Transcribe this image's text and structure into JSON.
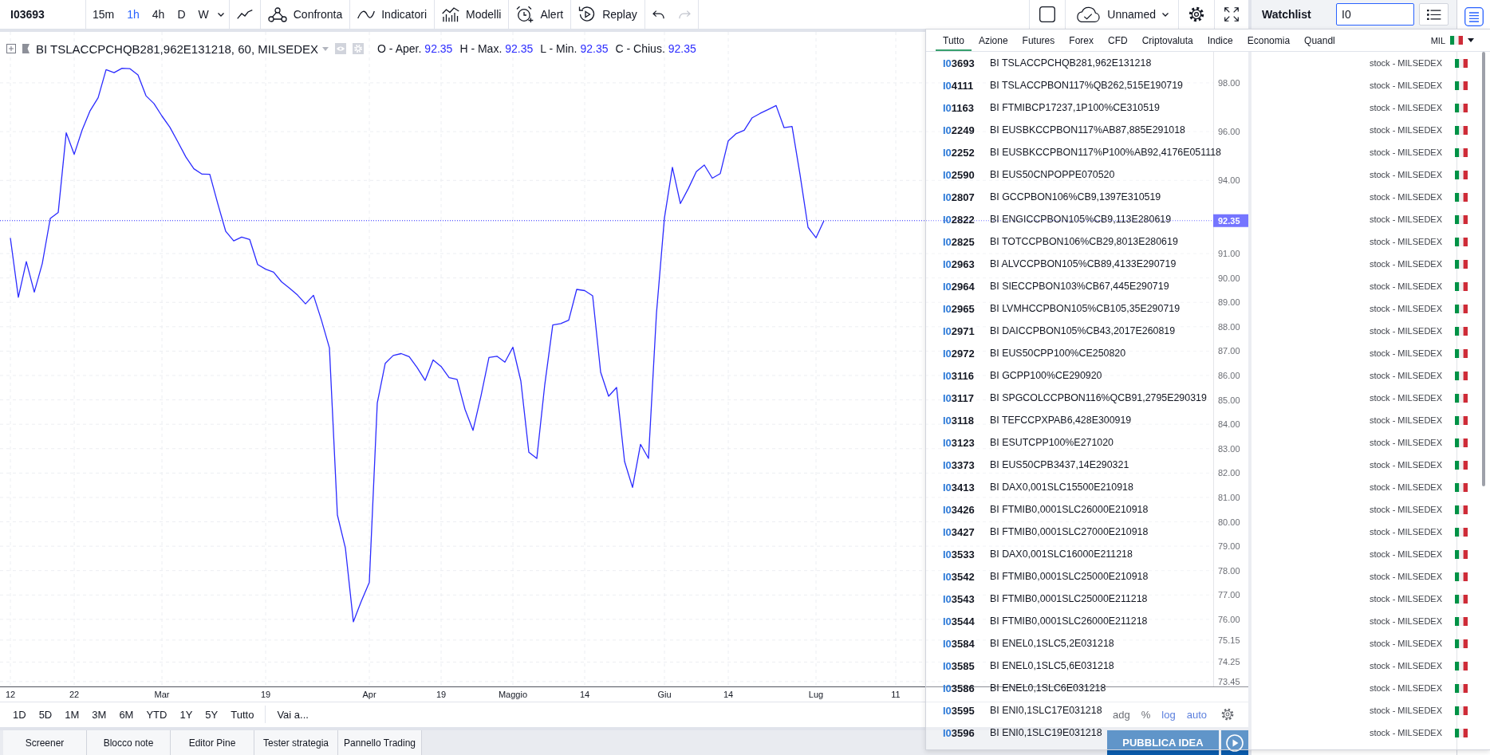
{
  "toolbar": {
    "symbol": "I03693",
    "intervals": [
      {
        "label": "15m",
        "selected": false
      },
      {
        "label": "1h",
        "selected": true
      },
      {
        "label": "4h",
        "selected": false
      },
      {
        "label": "D",
        "selected": false
      },
      {
        "label": "W",
        "selected": false
      }
    ],
    "tools": [
      {
        "label": "Confronta"
      },
      {
        "label": "Indicatori"
      },
      {
        "label": "Modelli"
      },
      {
        "label": "Alert"
      },
      {
        "label": "Replay"
      }
    ],
    "undo": {
      "disabled": false
    },
    "redo": {
      "disabled": true
    },
    "layout_name": "Unnamed"
  },
  "watchlist": {
    "title": "Watchlist",
    "search": {
      "value": "I0"
    }
  },
  "chart": {
    "legend": {
      "title": "BI TSLACCPCHQB281,962E131218, 60, MILSEDEX",
      "values": [
        {
          "label": "O - Aper.",
          "value": "92.35"
        },
        {
          "label": "H - Max.",
          "value": "92.35"
        },
        {
          "label": "L - Min.",
          "value": "92.35"
        },
        {
          "label": "C - Chius.",
          "value": "92.35"
        }
      ]
    },
    "chart_data": {
      "type": "line",
      "grid": true,
      "categories": [
        "12",
        null,
        null,
        null,
        null,
        null,
        null,
        null,
        "22",
        null,
        null,
        null,
        null,
        null,
        null,
        null,
        null,
        null,
        null,
        "Mar",
        null,
        null,
        null,
        null,
        null,
        null,
        null,
        null,
        null,
        null,
        null,
        null,
        "19",
        null,
        null,
        null,
        null,
        null,
        null,
        null,
        null,
        null,
        null,
        null,
        null,
        "Apr",
        null,
        null,
        null,
        null,
        null,
        null,
        null,
        null,
        "19",
        null,
        null,
        null,
        null,
        null,
        null,
        null,
        null,
        "Maggio",
        null,
        null,
        null,
        null,
        null,
        null,
        null,
        null,
        "14",
        null,
        null,
        null,
        null,
        null,
        null,
        null,
        null,
        null,
        "Giu",
        null,
        null,
        null,
        null,
        null,
        null,
        null,
        "14",
        null,
        null,
        null,
        null,
        null,
        null,
        null,
        null,
        null,
        null,
        "Lug",
        null,
        null,
        null,
        null,
        null,
        null,
        null,
        null,
        null,
        "11",
        null,
        null,
        null,
        null,
        null,
        null,
        null,
        null,
        null,
        null,
        null,
        null,
        null,
        null,
        null,
        null,
        null,
        null,
        null,
        null,
        null,
        null,
        null,
        null,
        null,
        null,
        null,
        null,
        null,
        null,
        null,
        null,
        null,
        null,
        null,
        null,
        null,
        null,
        null
      ],
      "series": [
        {
          "color": "#2b2bff",
          "values": [
            91.64,
            89.21,
            90.67,
            89.42,
            90.59,
            92.44,
            92.69,
            95.95,
            95.07,
            96.07,
            96.86,
            97.39,
            98.54,
            98.42,
            98.6,
            98.58,
            98.32,
            97.47,
            97.15,
            96.64,
            96.18,
            95.58,
            94.96,
            94.48,
            94.26,
            94.25,
            93.05,
            91.91,
            91.52,
            91.68,
            91.58,
            90.55,
            90.36,
            90.24,
            89.84,
            89.58,
            89.3,
            88.94,
            89.29,
            88.27,
            87.13,
            80.28,
            78.93,
            75.9,
            76.75,
            77.52,
            84.88,
            86.5,
            86.82,
            86.9,
            86.77,
            86.32,
            85.8,
            86.64,
            86.37,
            85.91,
            85.84,
            84.61,
            83.75,
            85.16,
            86.74,
            86.79,
            86.55,
            87.16,
            85.77,
            82.85,
            82.6,
            85.63,
            88.07,
            88.13,
            88.27,
            89.53,
            89.48,
            89.27,
            86.14,
            85.15,
            85.51,
            82.48,
            81.41,
            83.18,
            82.6,
            88.55,
            92.46,
            94.54,
            93.05,
            93.67,
            94.36,
            94.63,
            94.09,
            94.28,
            95.62,
            95.92,
            96.06,
            96.57,
            96.75,
            96.91,
            97.07,
            96.16,
            96.21,
            94.23,
            92.08,
            91.65,
            92.35,
            null,
            null,
            null,
            null,
            null,
            null,
            null,
            null,
            null,
            null,
            null,
            null,
            null,
            null,
            null,
            null,
            null,
            null,
            null,
            null,
            null,
            null,
            null,
            null,
            null,
            null,
            null,
            null,
            null,
            null,
            null,
            null,
            null,
            null,
            null,
            null,
            null,
            null,
            null,
            null,
            null,
            null,
            null,
            null,
            null,
            null,
            null,
            null
          ]
        }
      ],
      "ref_lines": [
        {
          "axis": "y",
          "value": 92.35,
          "label": "92.35",
          "color": "#2b2bff"
        }
      ],
      "ylim": [
        73.25,
        100.09
      ],
      "yticks": [
        {
          "value": 98,
          "label": "98.00"
        },
        {
          "value": 96,
          "label": "96.00"
        },
        {
          "value": 94,
          "label": "94.00"
        },
        {
          "value": 91,
          "label": "91.00"
        },
        {
          "value": 90,
          "label": "90.00"
        },
        {
          "value": 89,
          "label": "89.00"
        },
        {
          "value": 88,
          "label": "88.00"
        },
        {
          "value": 87,
          "label": "87.00"
        },
        {
          "value": 86,
          "label": "86.00"
        },
        {
          "value": 85,
          "label": "85.00"
        },
        {
          "value": 84,
          "label": "84.00"
        },
        {
          "value": 83,
          "label": "83.00"
        },
        {
          "value": 82,
          "label": "82.00"
        },
        {
          "value": 81,
          "label": "81.00"
        },
        {
          "value": 80,
          "label": "80.00"
        },
        {
          "value": 79,
          "label": "79.00"
        },
        {
          "value": 78,
          "label": "78.00"
        },
        {
          "value": 77,
          "label": "77.00"
        },
        {
          "value": 76,
          "label": "76.00"
        },
        {
          "value": 75.15,
          "label": "75.15"
        },
        {
          "value": 74.25,
          "label": "74.25"
        },
        {
          "value": 73.45,
          "label": "73.45"
        }
      ]
    }
  },
  "date_ranges": [
    "1D",
    "5D",
    "1M",
    "3M",
    "6M",
    "YTD",
    "1Y",
    "5Y",
    "Tutto"
  ],
  "go_to": "Vai a...",
  "scale_options": [
    {
      "label": "adg",
      "selected": false
    },
    {
      "label": "%",
      "selected": false
    },
    {
      "label": "log",
      "selected": true
    },
    {
      "label": "auto",
      "selected": true
    }
  ],
  "bottom_tabs": [
    "Screener",
    "Blocco note",
    "Editor Pine",
    "Tester strategia",
    "Pannello Trading"
  ],
  "publish_button": "PUBBLICA IDEA",
  "search_dropdown": {
    "tabs": [
      {
        "label": "Tutto",
        "selected": true
      },
      {
        "label": "Azione",
        "selected": false
      },
      {
        "label": "Futures",
        "selected": false
      },
      {
        "label": "Forex",
        "selected": false
      },
      {
        "label": "CFD",
        "selected": false
      },
      {
        "label": "Criptovaluta",
        "selected": false
      },
      {
        "label": "Indice",
        "selected": false
      },
      {
        "label": "Economia",
        "selected": false
      },
      {
        "label": "Quandl",
        "selected": false
      }
    ],
    "exchange": "MIL",
    "results": [
      {
        "match": "I0",
        "code": "3693",
        "description": "BI TSLACCPCHQB281,962E131218",
        "type": "stock - MILSEDEX"
      },
      {
        "match": "I0",
        "code": "4111",
        "description": "BI TSLACCPBON117%QB262,515E190719",
        "type": "stock - MILSEDEX"
      },
      {
        "match": "I0",
        "code": "1163",
        "description": "BI FTMIBCP17237,1P100%CE310519",
        "type": "stock - MILSEDEX"
      },
      {
        "match": "I0",
        "code": "2249",
        "description": "BI EUSBKCCPBON117%AB87,885E291018",
        "type": "stock - MILSEDEX"
      },
      {
        "match": "I0",
        "code": "2252",
        "description": "BI EUSBKCCPBON117%P100%AB92,4176E051118",
        "type": "stock - MILSEDEX"
      },
      {
        "match": "I0",
        "code": "2590",
        "description": "BI EUS50CNPOPPE070520",
        "type": "stock - MILSEDEX"
      },
      {
        "match": "I0",
        "code": "2807",
        "description": "BI GCCPBON106%CB9,1397E310519",
        "type": "stock - MILSEDEX"
      },
      {
        "match": "I0",
        "code": "2822",
        "description": "BI ENGICCPBON105%CB9,113E280619",
        "type": "stock - MILSEDEX"
      },
      {
        "match": "I0",
        "code": "2825",
        "description": "BI TOTCCPBON106%CB29,8013E280619",
        "type": "stock - MILSEDEX"
      },
      {
        "match": "I0",
        "code": "2963",
        "description": "BI ALVCCPBON105%CB89,4133E290719",
        "type": "stock - MILSEDEX"
      },
      {
        "match": "I0",
        "code": "2964",
        "description": "BI SIECCPBON103%CB67,445E290719",
        "type": "stock - MILSEDEX"
      },
      {
        "match": "I0",
        "code": "2965",
        "description": "BI LVMHCCPBON105%CB105,35E290719",
        "type": "stock - MILSEDEX"
      },
      {
        "match": "I0",
        "code": "2971",
        "description": "BI DAICCPBON105%CB43,2017E260819",
        "type": "stock - MILSEDEX"
      },
      {
        "match": "I0",
        "code": "2972",
        "description": "BI EUS50CPP100%CE250820",
        "type": "stock - MILSEDEX"
      },
      {
        "match": "I0",
        "code": "3116",
        "description": "BI GCPP100%CE290920",
        "type": "stock - MILSEDEX"
      },
      {
        "match": "I0",
        "code": "3117",
        "description": "BI SPGCOLCCPBON116%QCB91,2795E290319",
        "type": "stock - MILSEDEX"
      },
      {
        "match": "I0",
        "code": "3118",
        "description": "BI TEFCCPXPAB6,428E300919",
        "type": "stock - MILSEDEX"
      },
      {
        "match": "I0",
        "code": "3123",
        "description": "BI ESUTCPP100%E271020",
        "type": "stock - MILSEDEX"
      },
      {
        "match": "I0",
        "code": "3373",
        "description": "BI EUS50CPB3437,14E290321",
        "type": "stock - MILSEDEX"
      },
      {
        "match": "I0",
        "code": "3413",
        "description": "BI DAX0,001SLC15500E210918",
        "type": "stock - MILSEDEX"
      },
      {
        "match": "I0",
        "code": "3426",
        "description": "BI FTMIB0,0001SLC26000E210918",
        "type": "stock - MILSEDEX"
      },
      {
        "match": "I0",
        "code": "3427",
        "description": "BI FTMIB0,0001SLC27000E210918",
        "type": "stock - MILSEDEX"
      },
      {
        "match": "I0",
        "code": "3533",
        "description": "BI DAX0,001SLC16000E211218",
        "type": "stock - MILSEDEX"
      },
      {
        "match": "I0",
        "code": "3542",
        "description": "BI FTMIB0,0001SLC25000E210918",
        "type": "stock - MILSEDEX"
      },
      {
        "match": "I0",
        "code": "3543",
        "description": "BI FTMIB0,0001SLC25000E211218",
        "type": "stock - MILSEDEX"
      },
      {
        "match": "I0",
        "code": "3544",
        "description": "BI FTMIB0,0001SLC26000E211218",
        "type": "stock - MILSEDEX"
      },
      {
        "match": "I0",
        "code": "3584",
        "description": "BI ENEL0,1SLC5,2E031218",
        "type": "stock - MILSEDEX"
      },
      {
        "match": "I0",
        "code": "3585",
        "description": "BI ENEL0,1SLC5,6E031218",
        "type": "stock - MILSEDEX"
      },
      {
        "match": "I0",
        "code": "3586",
        "description": "BI ENEL0,1SLC6E031218",
        "type": "stock - MILSEDEX"
      },
      {
        "match": "I0",
        "code": "3595",
        "description": "BI ENI0,1SLC17E031218",
        "type": "stock - MILSEDEX"
      },
      {
        "match": "I0",
        "code": "3596",
        "description": "BI ENI0,1SLC19E031218",
        "type": "stock - MILSEDEX"
      }
    ]
  }
}
